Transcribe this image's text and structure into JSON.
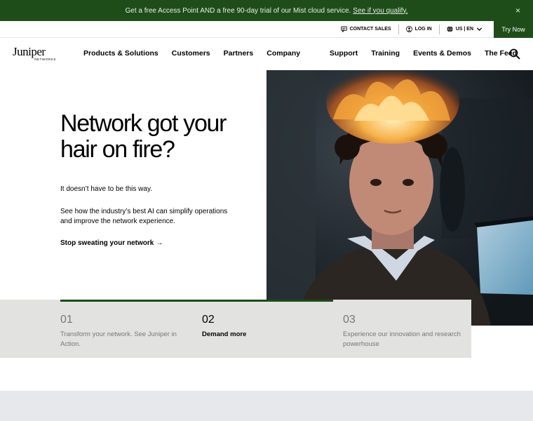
{
  "promo": {
    "text": "Get a free Access Point AND a free 90-day trial of our Mist cloud service.",
    "link": "See if you qualify.",
    "close_glyph": "×"
  },
  "utility": {
    "contact_sales": "CONTACT SALES",
    "log_in": "LOG IN",
    "locale": "US | EN",
    "try_now": "Try Now"
  },
  "brand": {
    "wordmark": "Juniper",
    "subtitle": "NETWORKS"
  },
  "nav": {
    "left": [
      "Products & Solutions",
      "Customers",
      "Partners",
      "Company"
    ],
    "right": [
      "Support",
      "Training",
      "Events & Demos",
      "The Feed"
    ]
  },
  "hero": {
    "headline": "Network got your hair on fire?",
    "lead": "It doesn’t have to be this way.",
    "body": "See how the industry’s best AI can simplify operations and improve the network experience.",
    "cta": "Stop sweating your network",
    "cta_arrow": "→"
  },
  "carousel": {
    "active_index": 1,
    "tabs": [
      {
        "num": "01",
        "label": "Transform your network. See Juniper in Action."
      },
      {
        "num": "02",
        "label": "Demand more"
      },
      {
        "num": "03",
        "label": "Experience our innovation and research powerhouse"
      }
    ]
  },
  "colors": {
    "brand_green": "#1e4d1a",
    "tab_bg": "#e2e3e0"
  }
}
